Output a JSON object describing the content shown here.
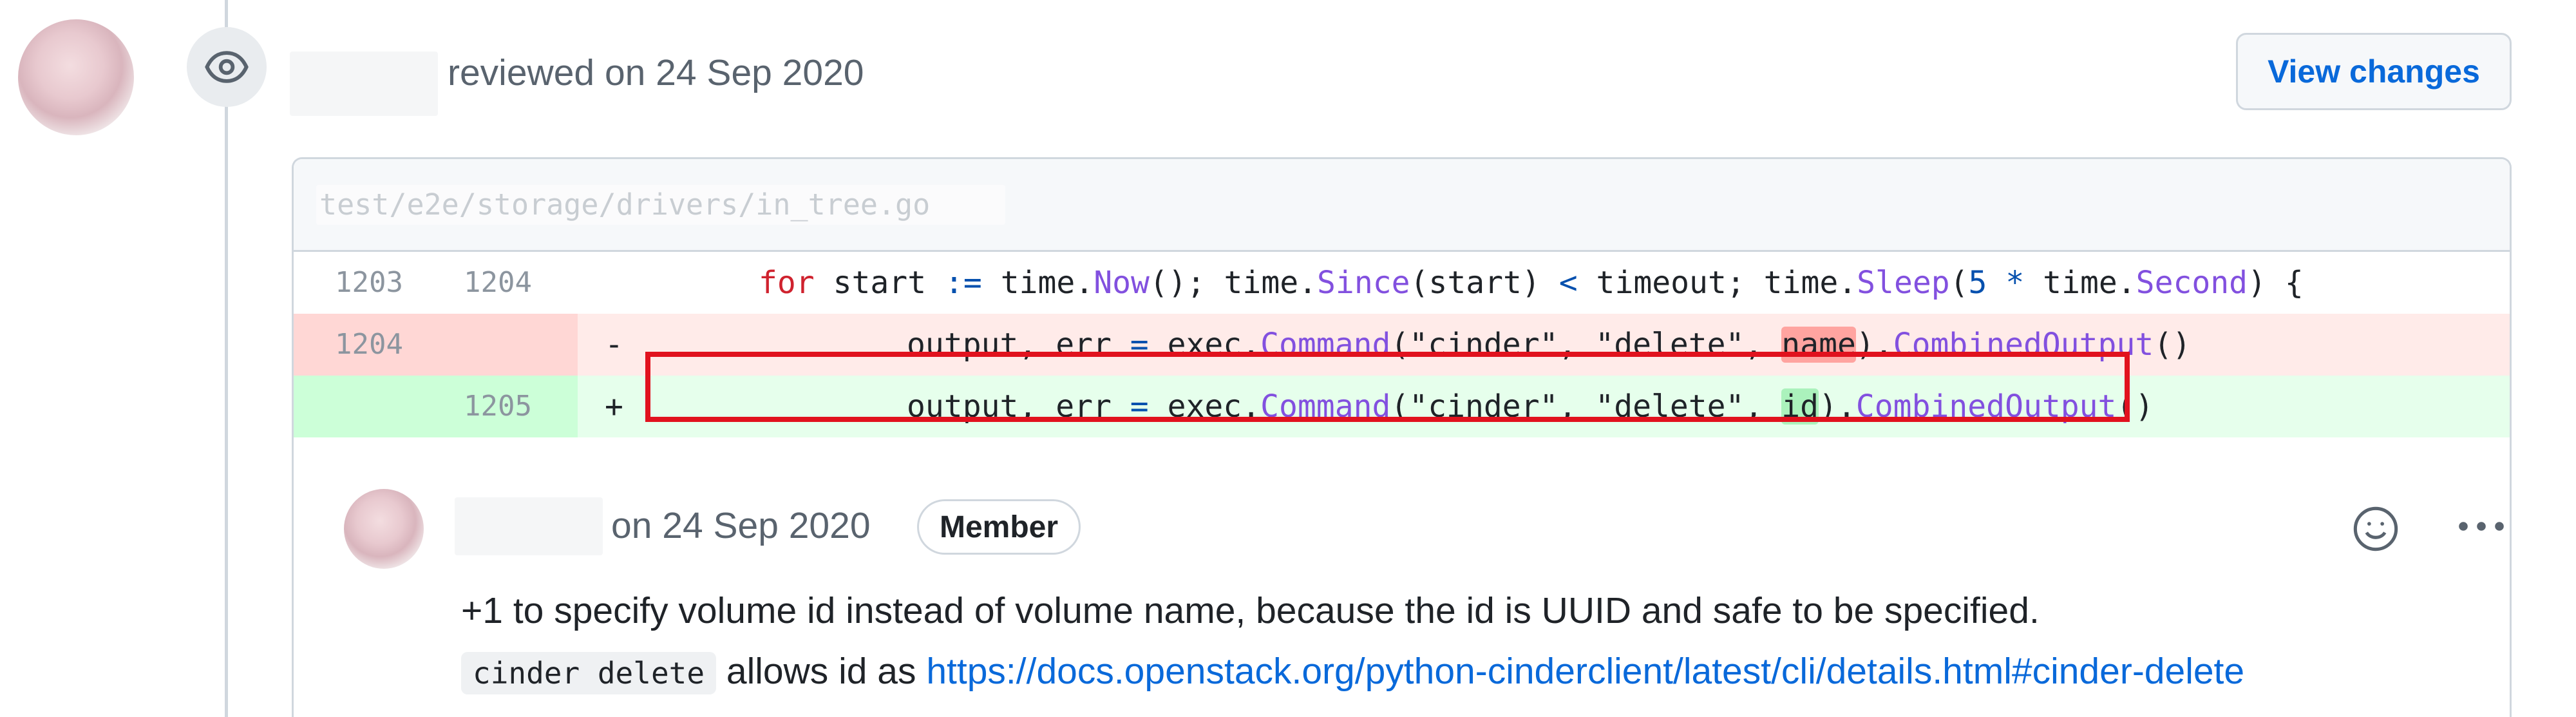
{
  "review": {
    "action": "reviewed on 24 Sep 2020",
    "view_changes_label": "View changes"
  },
  "diff": {
    "file_path": "test/e2e/storage/drivers/in_tree.go",
    "rows": [
      {
        "old": "1203",
        "new": "1204",
        "sign": "",
        "code": "for start := time.Now(); time.Since(start) < timeout; time.Sleep(5 * time.Second) {"
      },
      {
        "old": "1204",
        "new": "",
        "sign": "-",
        "code": "output, err = exec.Command(\"cinder\", \"delete\", name).CombinedOutput()"
      },
      {
        "old": "",
        "new": "1205",
        "sign": "+",
        "code": "output, err = exec.Command(\"cinder\", \"delete\", id).CombinedOutput()"
      }
    ],
    "tokens": {
      "for": "for",
      "start1": "start",
      "assign": ":=",
      "time": "time",
      "dot": ".",
      "now": "Now",
      "parens": "();",
      "since": "Since",
      "start2": "(start)",
      "lt": "<",
      "timeout": "timeout;",
      "sleep": "Sleep",
      "five": "5",
      "star": "*",
      "second": "Second",
      "brace": ") {",
      "output_err": "output, err",
      "eq": "=",
      "exec": "exec",
      "command": "Command",
      "args": "(\"cinder\", \"delete\", ",
      "name": "name",
      "id": "id",
      "close": ").",
      "combined": "CombinedOutput",
      "call": "()",
      "lparen": "(",
      "rparen": ")"
    }
  },
  "comment": {
    "date": "on 24 Sep 2020",
    "badge": "Member",
    "line1": "+1 to specify volume id instead of volume name, because the id is UUID and safe to be specified.",
    "code_snippet": "cinder delete",
    "line2_text": "allows id as",
    "link": "https://docs.openstack.org/python-cinderclient/latest/cli/details.html#cinder-delete"
  },
  "colors": {
    "link": "#0969da",
    "highlight_box": "#e1121e",
    "deletion_bg": "#ffebe9",
    "addition_bg": "#e6ffec"
  }
}
